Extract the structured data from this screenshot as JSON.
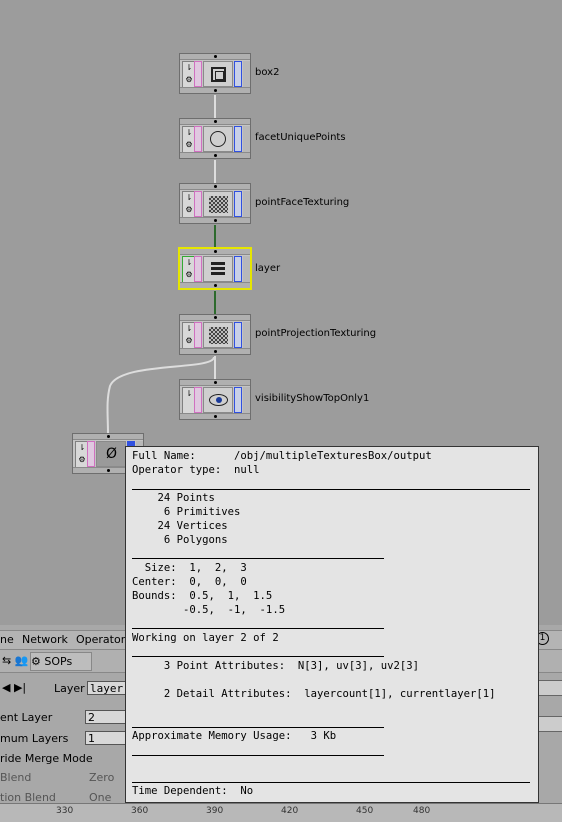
{
  "network": {
    "nodes": [
      {
        "name": "box2"
      },
      {
        "name": "facetUniquePoints"
      },
      {
        "name": "pointFaceTexturing"
      },
      {
        "name": "layer"
      },
      {
        "name": "pointProjectionTexturing"
      },
      {
        "name": "visibilityShowTopOnly1"
      }
    ],
    "output_node_icon": "Ø"
  },
  "menu": {
    "items": [
      "ne",
      "Network",
      "Operator"
    ]
  },
  "pathbar": {
    "context": "SOPs"
  },
  "params": {
    "layer_label": "Layer",
    "layer_value": "layer",
    "rows": [
      {
        "label": "ent Layer",
        "value": "2"
      },
      {
        "label": "mum Layers",
        "value": "1"
      },
      {
        "label": "ride Merge Mode",
        "value": ""
      },
      {
        "label": "Blend",
        "value": "Zero"
      },
      {
        "label": "tion Blend",
        "value": "One"
      }
    ]
  },
  "ruler": {
    "ticks": [
      "330",
      "360",
      "390",
      "420",
      "450",
      "480"
    ]
  },
  "info": {
    "full_name": "Full Name:      /obj/multipleTexturesBox/output",
    "op_type": "Operator type:  null",
    "points": "    24 Points",
    "prims": "     6 Primitives",
    "verts": "    24 Vertices",
    "polys": "     6 Polygons",
    "size": "  Size:  1,  2,  3",
    "center": "Center:  0,  0,  0",
    "bounds1": "Bounds:  0.5,  1,  1.5",
    "bounds2": "        -0.5,  -1,  -1.5",
    "working": "Working on layer 2 of 2",
    "point_attrs": "     3 Point Attributes:  N[3], uv[3], uv2[3]",
    "detail_attrs": "     2 Detail Attributes:  layercount[1], currentlayer[1]",
    "memory": "Approximate Memory Usage:   3 Kb",
    "time_dep": "Time Dependent:  No"
  }
}
